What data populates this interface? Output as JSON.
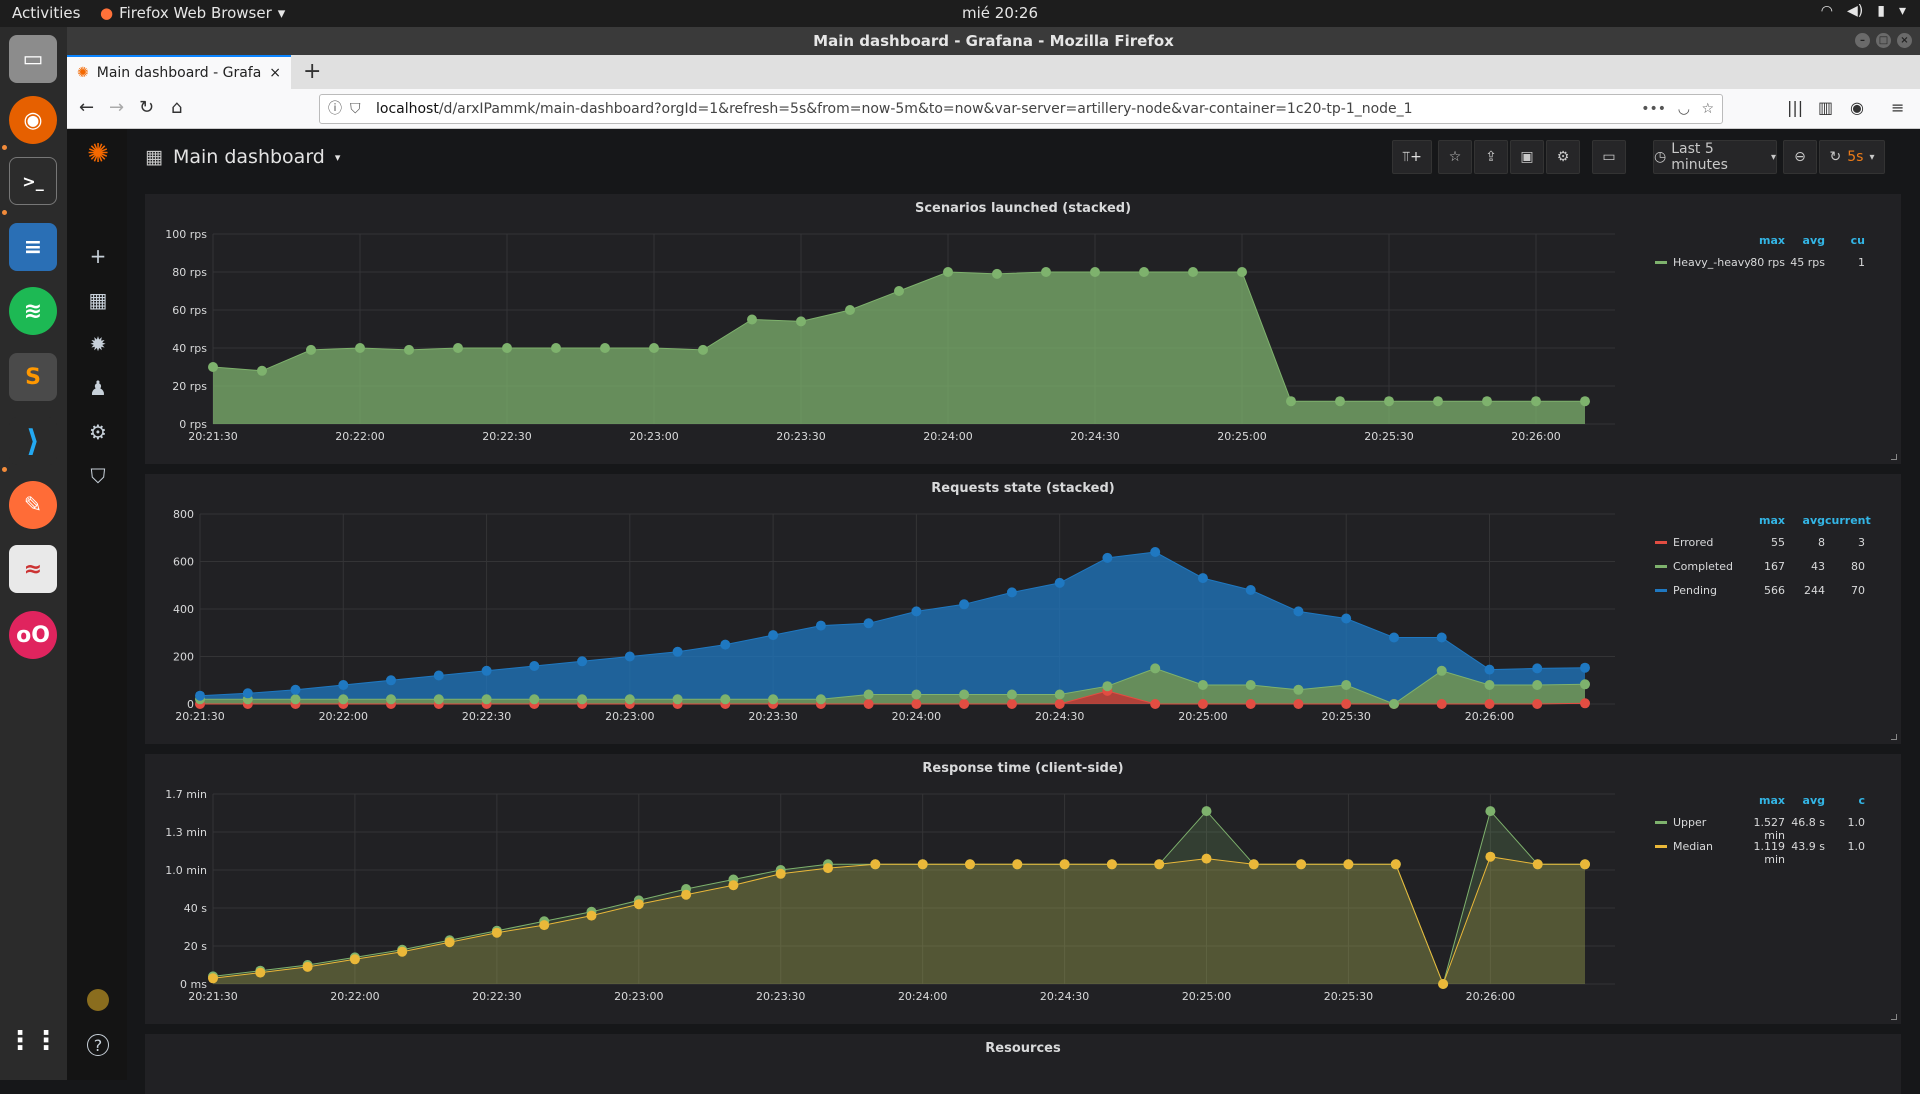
{
  "topbar": {
    "activities": "Activities",
    "app_name": "Firefox Web Browser",
    "clock": "mié 20:26"
  },
  "window": {
    "title": "Main dashboard - Grafana - Mozilla Firefox"
  },
  "tab": {
    "title": "Main dashboard - Grafana"
  },
  "url": {
    "host": "localhost",
    "path": "/d/arxIPammk/main-dashboard?orgId=1&refresh=5s&from=now-5m&to=now&var-server=artillery-node&var-container=1c20-tp-1_node_1"
  },
  "dashboard": {
    "title": "Main dashboard",
    "time_range": "Last 5 minutes",
    "refresh": "5s"
  },
  "colors": {
    "green": "#7eb26d",
    "blue": "#1f78c1",
    "yellow": "#eab839",
    "red": "#e24d42",
    "accent": "#33b5e5"
  },
  "x_ticks": [
    "20:21:30",
    "20:22:00",
    "20:22:30",
    "20:23:00",
    "20:23:30",
    "20:24:00",
    "20:24:30",
    "20:25:00",
    "20:25:30",
    "20:26:00"
  ],
  "panels": [
    {
      "title": "Scenarios launched (stacked)",
      "legend_headers": [
        "max",
        "avg",
        "cu"
      ],
      "legend": [
        {
          "name": "Heavy_-heavy",
          "color": "#7eb26d",
          "max": "80 rps",
          "avg": "45 rps",
          "current": "1"
        }
      ]
    },
    {
      "title": "Requests state (stacked)",
      "legend_headers": [
        "max",
        "avg",
        "current"
      ],
      "legend": [
        {
          "name": "Errored",
          "color": "#e24d42",
          "max": "55",
          "avg": "8",
          "current": "3"
        },
        {
          "name": "Completed",
          "color": "#7eb26d",
          "max": "167",
          "avg": "43",
          "current": "80"
        },
        {
          "name": "Pending",
          "color": "#1f78c1",
          "max": "566",
          "avg": "244",
          "current": "70"
        }
      ]
    },
    {
      "title": "Response time (client-side)",
      "legend_headers": [
        "max",
        "avg",
        "c"
      ],
      "legend": [
        {
          "name": "Upper",
          "color": "#7eb26d",
          "max": "1.527 min",
          "avg": "46.8 s",
          "current": "1.0"
        },
        {
          "name": "Median",
          "color": "#eab839",
          "max": "1.119 min",
          "avg": "43.9 s",
          "current": "1.0"
        }
      ]
    },
    {
      "title": "Resources"
    }
  ],
  "chart_data": [
    {
      "type": "area",
      "title": "Scenarios launched (stacked)",
      "y_ticks": [
        "0 rps",
        "20 rps",
        "40 rps",
        "60 rps",
        "80 rps",
        "100 rps"
      ],
      "ylim": [
        0,
        100
      ],
      "x": [
        "20:21:30",
        "20:21:35",
        "20:21:40",
        "20:21:45",
        "20:21:50",
        "20:21:55",
        "20:22:00",
        "20:22:05",
        "20:22:10",
        "20:22:15",
        "20:22:20",
        "20:22:25",
        "20:22:30",
        "20:22:35",
        "20:22:40",
        "20:22:45",
        "20:22:50",
        "20:22:55",
        "20:23:00",
        "20:23:05",
        "20:23:10",
        "20:23:15",
        "20:23:20",
        "20:23:25",
        "20:23:30",
        "20:23:35",
        "20:23:40",
        "20:23:45",
        "20:23:50",
        "20:23:55",
        "20:24:00",
        "20:24:05",
        "20:24:10",
        "20:24:15",
        "20:24:20",
        "20:24:25",
        "20:24:30",
        "20:24:35",
        "20:24:40",
        "20:24:45",
        "20:24:50",
        "20:24:55",
        "20:25:00",
        "20:25:05",
        "20:25:10",
        "20:25:15",
        "20:25:20",
        "20:25:25",
        "20:25:30",
        "20:25:35",
        "20:25:40",
        "20:25:45",
        "20:25:50",
        "20:25:55",
        "20:26:00",
        "20:26:05"
      ],
      "series": [
        {
          "name": "Heavy_-heavy",
          "color": "#7eb26d",
          "points": [
            [
              "20:21:30",
              30
            ],
            [
              "20:21:35",
              28
            ],
            [
              "20:21:40",
              39
            ],
            [
              "20:21:45",
              40
            ],
            [
              "20:21:50",
              39
            ],
            [
              "20:21:55",
              40
            ],
            [
              "20:22:00",
              40
            ],
            [
              "20:22:05",
              40
            ],
            [
              "20:22:10",
              40
            ],
            [
              "20:22:15",
              40
            ],
            [
              "20:22:20",
              39
            ],
            [
              "20:22:25",
              55
            ],
            [
              "20:22:30",
              54
            ],
            [
              "20:22:35",
              60
            ],
            [
              "20:22:40",
              70
            ],
            [
              "20:22:45",
              80
            ],
            [
              "20:22:50",
              79
            ],
            [
              "20:22:55",
              80
            ],
            [
              "20:23:00",
              80
            ],
            [
              "20:23:05",
              80
            ],
            [
              "20:23:10",
              80
            ],
            [
              "20:23:15",
              80
            ],
            [
              "20:23:20",
              12
            ],
            [
              "20:23:25",
              12
            ],
            [
              "20:23:30",
              12
            ],
            [
              "20:23:35",
              12
            ],
            [
              "20:23:40",
              12
            ],
            [
              "20:23:45",
              12
            ],
            [
              "20:23:50",
              12
            ]
          ]
        }
      ]
    },
    {
      "type": "area",
      "title": "Requests state (stacked)",
      "y_ticks": [
        "0",
        "200",
        "400",
        "600",
        "800"
      ],
      "ylim": [
        0,
        800
      ],
      "series": [
        {
          "name": "Errored",
          "color": "#e24d42",
          "values": [
            0,
            0,
            0,
            0,
            0,
            0,
            0,
            0,
            0,
            0,
            0,
            0,
            0,
            0,
            0,
            0,
            0,
            0,
            0,
            55,
            0,
            0,
            0,
            0,
            0,
            0,
            0,
            0,
            0,
            3
          ]
        },
        {
          "name": "Completed",
          "color": "#7eb26d",
          "values": [
            20,
            20,
            20,
            20,
            20,
            20,
            20,
            20,
            20,
            20,
            20,
            20,
            20,
            20,
            40,
            40,
            40,
            40,
            40,
            20,
            150,
            80,
            80,
            60,
            80,
            0,
            140,
            80,
            80,
            80
          ]
        },
        {
          "name": "Pending",
          "color": "#1f78c1",
          "values": [
            15,
            25,
            40,
            60,
            80,
            100,
            120,
            140,
            160,
            180,
            200,
            230,
            270,
            310,
            300,
            350,
            380,
            430,
            470,
            540,
            490,
            450,
            400,
            330,
            280,
            280,
            140,
            65,
            70,
            70
          ]
        }
      ]
    },
    {
      "type": "area",
      "title": "Response time (client-side)",
      "y_ticks": [
        "0 ms",
        "20 s",
        "40 s",
        "1.0 min",
        "1.3 min",
        "1.7 min"
      ],
      "ylim": [
        0,
        100
      ],
      "series": [
        {
          "name": "Upper",
          "color": "#7eb26d",
          "values": [
            4,
            7,
            10,
            14,
            18,
            23,
            28,
            33,
            38,
            44,
            50,
            55,
            60,
            63,
            63,
            63,
            63,
            63,
            63,
            63,
            63,
            91,
            63,
            63,
            63,
            63,
            0,
            91,
            63,
            63
          ]
        },
        {
          "name": "Median",
          "color": "#eab839",
          "values": [
            3,
            6,
            9,
            13,
            17,
            22,
            27,
            31,
            36,
            42,
            47,
            52,
            58,
            61,
            63,
            63,
            63,
            63,
            63,
            63,
            63,
            66,
            63,
            63,
            63,
            63,
            0,
            67,
            63,
            63
          ]
        }
      ]
    }
  ]
}
